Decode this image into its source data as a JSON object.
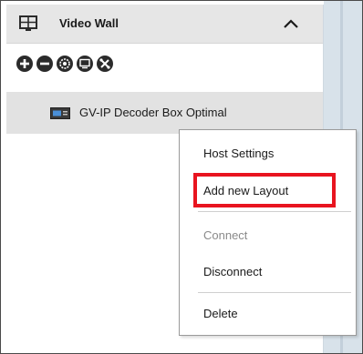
{
  "panel": {
    "title": "Video Wall",
    "toolbar_buttons": [
      "add-icon",
      "remove-icon",
      "settings-icon",
      "monitor-icon",
      "tools-icon"
    ]
  },
  "device": {
    "label": "GV-IP Decoder Box Optimal",
    "icon": "decoder-box-icon"
  },
  "context_menu": {
    "items": [
      {
        "label": "Host Settings",
        "enabled": true
      },
      {
        "label": "Add new Layout",
        "enabled": true,
        "highlighted": true
      },
      {
        "label": "Connect",
        "enabled": false
      },
      {
        "label": "Disconnect",
        "enabled": true
      },
      {
        "label": "Delete",
        "enabled": true
      }
    ]
  },
  "colors": {
    "highlight_border": "#e8141f",
    "header_bg": "#e6e6e6",
    "selected_row_bg": "#e2e2e2",
    "disabled_text": "#8a8a8a"
  }
}
